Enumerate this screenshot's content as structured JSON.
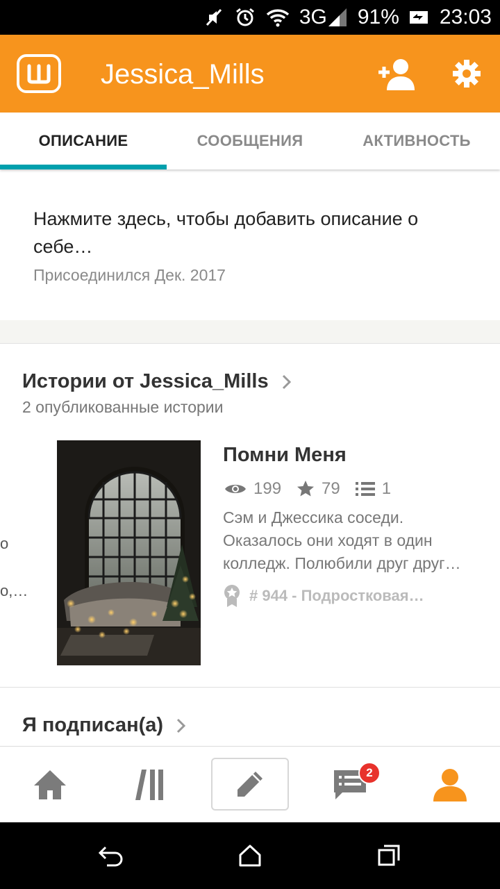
{
  "status_bar": {
    "icons": [
      "mute-icon",
      "alarm-icon",
      "wifi-icon",
      "signal-icon",
      "battery-icon"
    ],
    "network": "3G",
    "battery": "91%",
    "time": "23:03"
  },
  "header": {
    "logo_icon": "wattpad-logo-icon",
    "title": "Jessica_Mills",
    "add_user_icon": "add-user-icon",
    "settings_icon": "gear-icon",
    "accent_color": "#f7941d"
  },
  "tabs": [
    {
      "label": "ОПИСАНИЕ",
      "active": true
    },
    {
      "label": "СООБЩЕНИЯ",
      "active": false
    },
    {
      "label": "АКТИВНОСТЬ",
      "active": false
    }
  ],
  "description": {
    "prompt": "Нажмите здесь, чтобы добавить описание о себе…",
    "joined": "Присоединился Дек. 2017"
  },
  "stories_section": {
    "title": "Истории от Jessica_Mills",
    "subtitle": "2 опубликованные истории",
    "peek_lines": [
      "о",
      "о,…"
    ],
    "story": {
      "title": "Помни Меня",
      "reads": "199",
      "votes": "79",
      "parts": "1",
      "description_lines": [
        "Сэм и Джессика соседи.",
        "Оказалось они ходят в один",
        "колледж. Полюбили друг друг…"
      ],
      "rank": "# 944 - Подростковая…"
    }
  },
  "following_section": {
    "title": "Я подписан(а)"
  },
  "bottom_nav": {
    "items": [
      "home-icon",
      "library-icon",
      "write-icon",
      "messages-icon",
      "profile-icon"
    ],
    "messages_badge": "2",
    "active_color": "#f7941d"
  },
  "system_nav": {
    "items": [
      "back-icon",
      "home-icon",
      "recents-icon"
    ]
  }
}
